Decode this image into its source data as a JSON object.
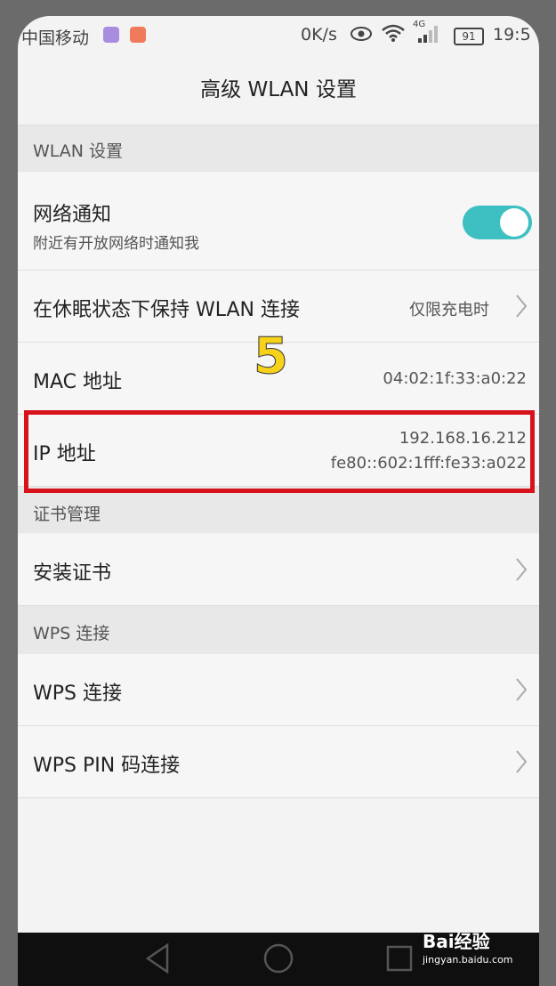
{
  "status_bar": {
    "carrier": "中国移动",
    "net_speed": "0K/s",
    "network_type": "4G",
    "battery": "91",
    "time": "19:5"
  },
  "header": {
    "title": "高级 WLAN 设置"
  },
  "sections": {
    "wlan": "WLAN 设置",
    "cert": "证书管理",
    "wps": "WPS 连接"
  },
  "rows": {
    "network_notify": {
      "label": "网络通知",
      "sub": "附近有开放网络时通知我",
      "toggle_on": true
    },
    "sleep_keep": {
      "label": "在休眠状态下保持 WLAN 连接",
      "value": "仅限充电时"
    },
    "mac": {
      "label": "MAC 地址",
      "value": "04:02:1f:33:a0:22"
    },
    "ip": {
      "label": "IP 地址",
      "value_v4": "192.168.16.212",
      "value_v6": "fe80::602:1fff:fe33:a022"
    },
    "install_cert": {
      "label": "安装证书"
    },
    "wps_connect": {
      "label": "WPS 连接"
    },
    "wps_pin": {
      "label": "WPS PIN 码连接"
    }
  },
  "annotation": {
    "step": "5",
    "highlight_color": "#d8121b"
  },
  "watermark": {
    "brand": "Bai经验",
    "url": "jingyan.baidu.com"
  },
  "colors": {
    "accent": "#3ebfc1"
  }
}
